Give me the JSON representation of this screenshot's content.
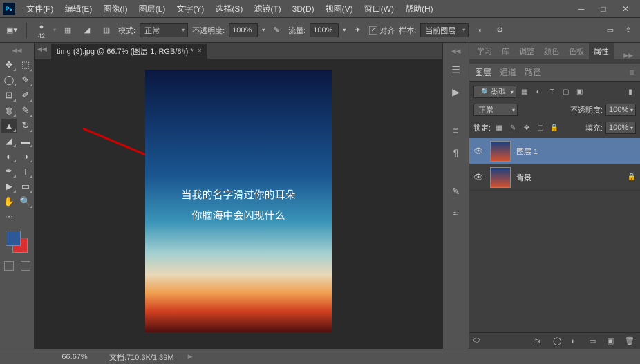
{
  "menu": {
    "file": "文件(F)",
    "edit": "编辑(E)",
    "image": "图像(I)",
    "layer": "图层(L)",
    "type": "文字(Y)",
    "select": "选择(S)",
    "filter": "滤镜(T)",
    "threed": "3D(D)",
    "view": "视图(V)",
    "window": "窗口(W)",
    "help": "帮助(H)"
  },
  "options": {
    "brush_size": "42",
    "mode_label": "模式:",
    "mode_value": "正常",
    "opacity_label": "不透明度:",
    "opacity_value": "100%",
    "flow_label": "流量:",
    "flow_value": "100%",
    "aligned_label": "对齐",
    "sample_label": "样本:",
    "sample_value": "当前图层"
  },
  "doc": {
    "tab_title": "timg (3).jpg @ 66.7% (图层 1, RGB/8#) *",
    "text_line1": "当我的名字滑过你的耳朵",
    "text_line2": "你脑海中会闪现什么"
  },
  "panels": {
    "tabs": [
      "学习",
      "库",
      "调整",
      "颜色",
      "色板",
      "属性"
    ],
    "active_tab_index": 5,
    "layers": {
      "tab_layers": "图层",
      "tab_channels": "通道",
      "tab_paths": "路径",
      "kind_label": "类型",
      "blend_mode": "正常",
      "opacity_label": "不透明度:",
      "opacity_value": "100%",
      "lock_label": "锁定:",
      "fill_label": "填充:",
      "fill_value": "100%",
      "items": [
        {
          "name": "图层 1",
          "selected": true,
          "locked": false
        },
        {
          "name": "背景",
          "selected": false,
          "locked": true
        }
      ]
    }
  },
  "status": {
    "zoom": "66.67%",
    "doc_info": "文档:710.3K/1.39M"
  }
}
